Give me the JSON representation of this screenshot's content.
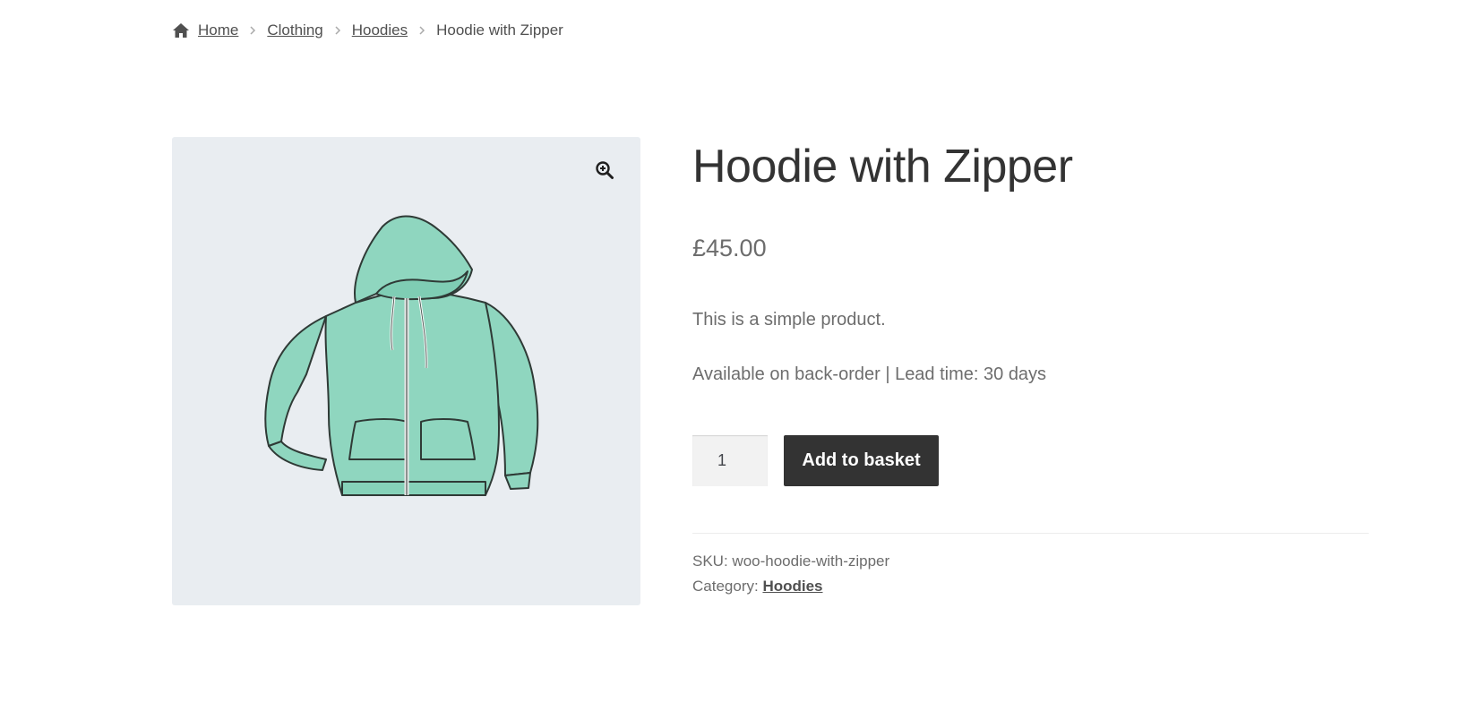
{
  "breadcrumb": {
    "home": "Home",
    "items": [
      "Clothing",
      "Hoodies"
    ],
    "current": "Hoodie with Zipper"
  },
  "product": {
    "title": "Hoodie with Zipper",
    "price": "£45.00",
    "short_description": "This is a simple product.",
    "stock_status": "Available on back-order | Lead time: 30 days",
    "quantity": "1",
    "add_to_basket_label": "Add to basket",
    "sku_label": "SKU:",
    "sku_value": "woo-hoodie-with-zipper",
    "category_label": "Category:",
    "category_value": "Hoodies"
  },
  "icons": {
    "home": "home-icon",
    "separator": "chevron-right-icon",
    "zoom": "zoom-in-icon"
  },
  "colors": {
    "button_bg": "#333333",
    "gallery_bg": "#e9edf1",
    "hoodie_fill": "#8fd6bf"
  }
}
